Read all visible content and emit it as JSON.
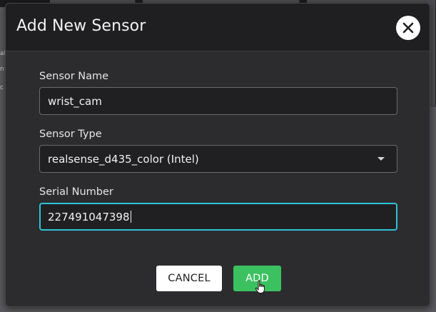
{
  "dialog": {
    "title": "Add New Sensor",
    "close_icon": "close-icon"
  },
  "form": {
    "sensor_name": {
      "label": "Sensor Name",
      "value": "wrist_cam"
    },
    "sensor_type": {
      "label": "Sensor Type",
      "selected": "realsense_d435_color (Intel)",
      "arrow_icon": "caret-down-icon"
    },
    "serial_number": {
      "label": "Serial Number",
      "value": "227491047398"
    }
  },
  "actions": {
    "cancel_label": "CANCEL",
    "add_label": "ADD"
  },
  "background": {
    "side_texts": [
      "al",
      "n",
      "c"
    ]
  },
  "colors": {
    "accent_focus": "#2ec4d6",
    "add_button": "#3cc160",
    "dialog_bg": "#2c2c2f",
    "header_bg": "#1f1f21"
  }
}
